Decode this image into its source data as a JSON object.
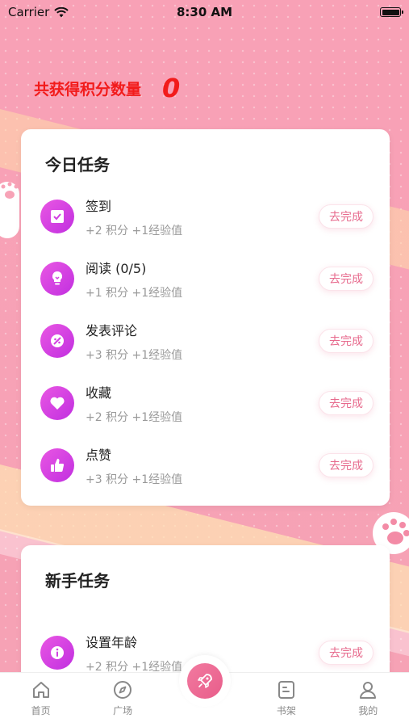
{
  "status_bar": {
    "carrier": "Carrier",
    "time": "8:30 AM"
  },
  "points": {
    "label": "共获得积分数量",
    "value": "0"
  },
  "daily": {
    "title": "今日任务",
    "tasks": [
      {
        "name": "签到",
        "reward": "+2 积分 +1经验值",
        "button": "去完成",
        "icon": "checkbox-icon"
      },
      {
        "name": "阅读 (0/5)",
        "reward": "+1 积分 +1经验值",
        "button": "去完成",
        "icon": "lightbulb-icon"
      },
      {
        "name": "发表评论",
        "reward": "+3 积分 +1经验值",
        "button": "去完成",
        "icon": "comment-icon"
      },
      {
        "name": "收藏",
        "reward": "+2 积分 +1经验值",
        "button": "去完成",
        "icon": "heart-icon"
      },
      {
        "name": "点赞",
        "reward": "+3 积分 +1经验值",
        "button": "去完成",
        "icon": "thumbs-up-icon"
      }
    ]
  },
  "newbie": {
    "title": "新手任务",
    "tasks": [
      {
        "name": "设置年龄",
        "reward": "+2 积分 +1经验值",
        "button": "去完成",
        "icon": "info-icon"
      }
    ]
  },
  "tabbar": {
    "items": [
      {
        "label": "首页",
        "icon": "home-icon"
      },
      {
        "label": "广场",
        "icon": "compass-icon"
      },
      {
        "label": "",
        "icon": "rocket-icon"
      },
      {
        "label": "书架",
        "icon": "bookshelf-icon"
      },
      {
        "label": "我的",
        "icon": "profile-icon"
      }
    ]
  },
  "colors": {
    "accent": "#e85d8a",
    "points_red": "#f21b1b",
    "task_icon": "#d140e2"
  }
}
